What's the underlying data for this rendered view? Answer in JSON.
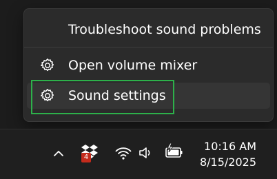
{
  "context_menu": {
    "items": [
      {
        "label": "Troubleshoot sound problems",
        "icon": null
      },
      {
        "label": "Open volume mixer",
        "icon": "gear-icon"
      },
      {
        "label": "Sound settings",
        "icon": "gear-icon"
      }
    ]
  },
  "taskbar": {
    "tray_icons": [
      "chevron-up-icon",
      "dropbox-icon",
      "wifi-icon",
      "volume-icon",
      "battery-charging-icon"
    ],
    "dropbox_badge": "4",
    "time": "10:16 AM",
    "date": "8/15/2025"
  },
  "colors": {
    "menu_background": "#2b2b2b",
    "hover_background": "#353535",
    "highlight_outline": "#2db14a",
    "badge": "#c42b1c",
    "taskbar_background": "#1f1f1f"
  }
}
